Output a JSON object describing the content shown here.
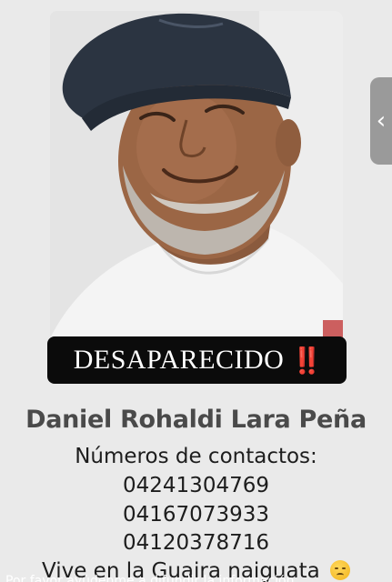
{
  "poster": {
    "badge_text": "DESAPARECIDO",
    "badge_mark": "‼️",
    "name": "Daniel Rohaldi Lara Peña",
    "contacts_label": "Números de contactos:",
    "phones": [
      "04241304769",
      "04167073933",
      "04120378716"
    ],
    "lives_text": "Vive en la Guaira naiguata",
    "lives_emoji": "pensive-face-emoji",
    "photo": "portrait-man-cap-smiling"
  },
  "side_tab": {
    "icon": "chevron-left-icon",
    "glyph": "‹"
  },
  "bottom_caption": {
    "text": "Por favor ayúdenme a difundir la información"
  },
  "colors": {
    "badge_bg": "#0b0b0b",
    "badge_mark": "#e01b1b",
    "name_text": "#4a4a4a",
    "body_text": "#1d1d1d",
    "background": "#eaeaea"
  }
}
